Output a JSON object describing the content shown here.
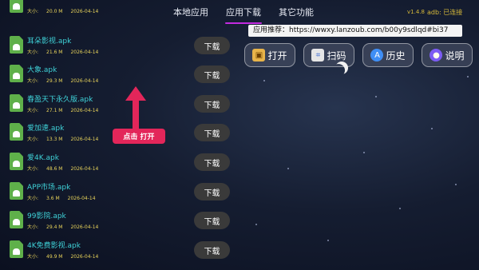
{
  "tabs": [
    {
      "label": "本地应用"
    },
    {
      "label": "应用下载"
    },
    {
      "label": "其它功能"
    }
  ],
  "version": "v1.4.8",
  "adb_status": "adb: 已连接",
  "recommend": "应用推荐：https://wwxy.lanzoub.com/b00y9sdlqd#bi37",
  "actions": [
    {
      "label": "打开",
      "icon": "box-icon"
    },
    {
      "label": "扫码",
      "icon": "scan-icon"
    },
    {
      "label": "历史",
      "icon": "appstore-icon"
    },
    {
      "label": "说明",
      "icon": "bulb-icon"
    }
  ],
  "files": [
    {
      "name": "",
      "size_label": "大小:",
      "size": "20.0 M",
      "date": "2026-04-14"
    },
    {
      "name": "耳朵影视.apk",
      "size_label": "大小:",
      "size": "21.6 M",
      "date": "2026-04-14"
    },
    {
      "name": "大象.apk",
      "size_label": "大小:",
      "size": "29.3 M",
      "date": "2026-04-14"
    },
    {
      "name": "春盈天下永久版.apk",
      "size_label": "大小:",
      "size": "27.1 M",
      "date": "2026-04-14"
    },
    {
      "name": "爱加速.apk",
      "size_label": "大小:",
      "size": "13.3 M",
      "date": "2026-04-14"
    },
    {
      "name": "爱4K.apk",
      "size_label": "大小:",
      "size": "48.6 M",
      "date": "2026-04-14"
    },
    {
      "name": "APP市场.apk",
      "size_label": "大小:",
      "size": "3.6 M",
      "date": "2026-04-14"
    },
    {
      "name": "99影院.apk",
      "size_label": "大小:",
      "size": "29.4 M",
      "date": "2026-04-14"
    },
    {
      "name": "4K免费影视.apk",
      "size_label": "大小:",
      "size": "49.9 M",
      "date": "2026-04-14"
    }
  ],
  "download_label": "下载",
  "tooltip": "点击 打开",
  "colors": {
    "accent": "#c32be0",
    "filename": "#3fd2d8",
    "meta": "#e8d35a",
    "tooltip": "#e3265a",
    "status": "#d6b93a"
  }
}
